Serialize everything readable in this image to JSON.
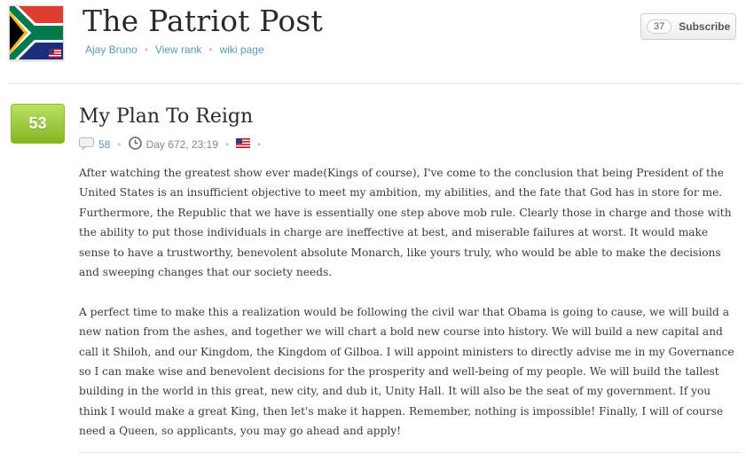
{
  "newspaper": {
    "name": "The Patriot Post",
    "links": [
      "Ajay Bruno",
      "View rank",
      "wiki page"
    ],
    "avatar_icon": "south-africa-flag-icon",
    "country_badge_icon": "usa-flag-icon"
  },
  "subscribe": {
    "count": "37",
    "label": "Subscribe"
  },
  "article": {
    "votes": "53",
    "title": "My Plan To Reign",
    "comments": "58",
    "date": "Day 672, 23:19",
    "country_icon": "usa-flag-icon",
    "paragraphs": [
      "After watching the greatest show ever made(Kings of course), I've come to the conclusion that being President of the United States is an insufficient objective to meet my ambition, my abilities, and the fate that God has in store for me. Furthermore, the Republic that we have is essentially one step above mob rule. Clearly those in charge and those with the ability to put those individuals in charge are ineffective at best, and miserable failures at worst. It would make sense to have a trustworthy, benevolent absolute Monarch, like yours truly, who would be able to make the decisions and sweeping changes that our society needs.",
      "A perfect time to make this a realization would be following the civil war that Obama is going to cause, we will build a new nation from the ashes, and together we will chart a bold new course into history. We will build a new capital and call it Shiloh, and our Kingdom, the Kingdom of Gilboa. I will appoint ministers to directly advise me in my Governance so I can make wise and benevolent decisions for the prosperity and well-being of my people. We will build the tallest building in the world in this great, new city, and dub it, Unity Hall. It will also be the seat of my government. If you think I would make a great King, then let's make it happen. Remember, nothing is impossible! Finally, I will of course need a Queen, so applicants, you may go ahead and apply!"
    ]
  },
  "colors": {
    "link": "#5a9ab8",
    "vote_green": "#8dc02b",
    "text": "#3a3a3a"
  }
}
